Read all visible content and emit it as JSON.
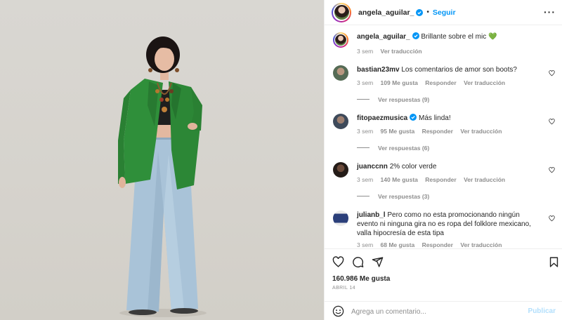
{
  "post": {
    "author": "angela_aguilar_",
    "follow_label": "Seguir",
    "more_label": "···",
    "caption_text": "Brillante sobre el mic",
    "caption_emoji": "💚",
    "caption_time": "3 sem",
    "caption_translate": "Ver traducción"
  },
  "comments": [
    {
      "user": "bastian23mv",
      "text": "Los comentarios de amor son boots?",
      "time": "3 sem",
      "likes": "109 Me gusta",
      "reply": "Responder",
      "translate": "Ver traducción",
      "replies": "Ver respuestas (9)",
      "verified": false
    },
    {
      "user": "fitopaezmusica",
      "text": "Más linda!",
      "time": "3 sem",
      "likes": "95 Me gusta",
      "reply": "Responder",
      "translate": "Ver traducción",
      "replies": "Ver respuestas (6)",
      "verified": true
    },
    {
      "user": "juancсnn",
      "text": "2% color verde",
      "time": "3 sem",
      "likes": "140 Me gusta",
      "reply": "Responder",
      "translate": "Ver traducción",
      "replies": "Ver respuestas (3)",
      "verified": false
    },
    {
      "user": "julianb_l",
      "text": "Pero como no esta promocionando ningún evento ni ninguna gira no es ropa del folklore mexicano, valla hipocresía de esta tipa",
      "time": "3 sem",
      "likes": "68 Me gusta",
      "reply": "Responder",
      "translate": "Ver traducción",
      "replies": "",
      "verified": false
    }
  ],
  "footer": {
    "likes": "160.986 Me gusta",
    "date": "ABRIL 14",
    "comment_placeholder": "Agrega un comentario...",
    "publish_label": "Publicar"
  },
  "icons": {
    "like": "heart-icon",
    "comment": "comment-icon",
    "share": "share-icon",
    "save": "bookmark-icon",
    "emoji": "emoji-icon",
    "verified": "verified-badge-icon"
  },
  "colors": {
    "accent": "#0095f6",
    "muted": "#8e8e8e",
    "text": "#262626",
    "publish_disabled": "#b2dffc",
    "jacket_green": "#2f8f3a"
  }
}
